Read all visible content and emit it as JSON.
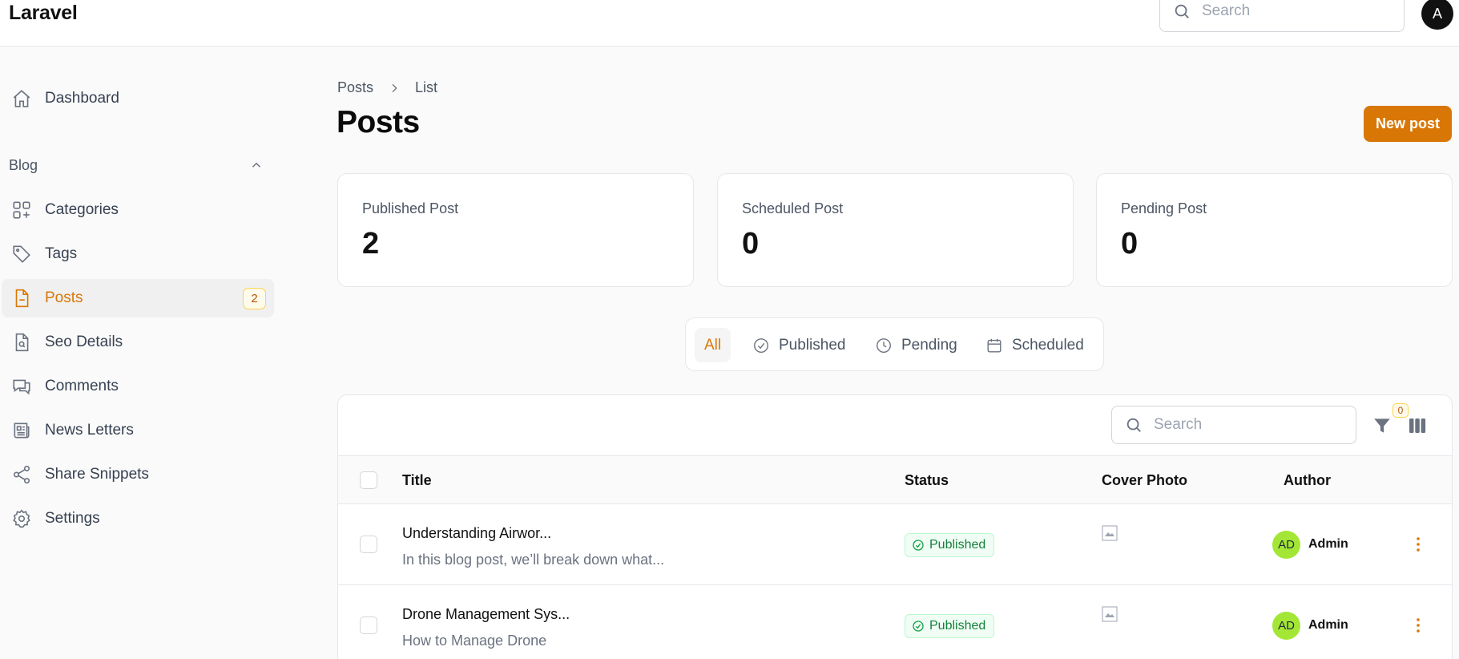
{
  "app": {
    "brand": "Laravel"
  },
  "topbar": {
    "search_placeholder": "Search",
    "avatar_initial": "A"
  },
  "sidebar": {
    "items": [
      {
        "label": "Dashboard",
        "icon": "home-icon"
      },
      {
        "label": "Categories",
        "icon": "squares-plus-icon"
      },
      {
        "label": "Tags",
        "icon": "tag-icon"
      },
      {
        "label": "Posts",
        "icon": "document-icon",
        "badge": "2",
        "active": true
      },
      {
        "label": "Seo Details",
        "icon": "document-search-icon"
      },
      {
        "label": "Comments",
        "icon": "chat-icon"
      },
      {
        "label": "News Letters",
        "icon": "newspaper-icon"
      },
      {
        "label": "Share Snippets",
        "icon": "share-icon"
      },
      {
        "label": "Settings",
        "icon": "gear-icon"
      }
    ],
    "group_label": "Blog"
  },
  "breadcrumb": {
    "parent": "Posts",
    "current": "List"
  },
  "page": {
    "title": "Posts",
    "new_button": "New post"
  },
  "stats": [
    {
      "label": "Published Post",
      "value": "2"
    },
    {
      "label": "Scheduled Post",
      "value": "0"
    },
    {
      "label": "Pending Post",
      "value": "0"
    }
  ],
  "tabs": [
    {
      "label": "All",
      "active": true
    },
    {
      "label": "Published",
      "icon": "check-circle-icon"
    },
    {
      "label": "Pending",
      "icon": "clock-icon"
    },
    {
      "label": "Scheduled",
      "icon": "calendar-icon"
    }
  ],
  "table": {
    "search_placeholder": "Search",
    "filter_count": "0",
    "columns": [
      "Title",
      "Status",
      "Cover Photo",
      "Author"
    ],
    "rows": [
      {
        "title": "Understanding Airwor...",
        "excerpt": "In this blog post, we’ll break down what...",
        "status": "Published",
        "author_initials": "AD",
        "author": "Admin"
      },
      {
        "title": "Drone Management Sys...",
        "excerpt": "How to Manage Drone",
        "status": "Published",
        "author_initials": "AD",
        "author": "Admin"
      }
    ]
  },
  "colors": {
    "accent": "#d97706",
    "success": "#15803d",
    "avatar": "#a3e635"
  }
}
